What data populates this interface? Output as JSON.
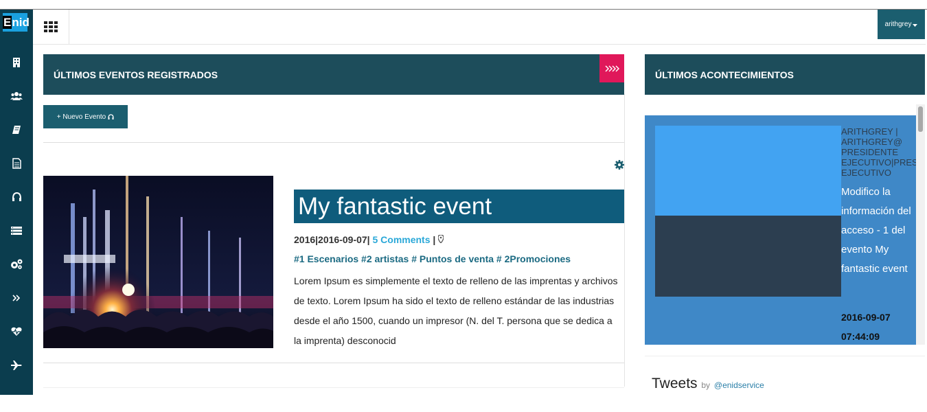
{
  "sidebar": {
    "logo_text": "Enid",
    "logo_first": "E",
    "logo_rest": "nid",
    "icons": [
      "building-icon",
      "users-icon",
      "book-icon",
      "document-icon",
      "headset-icon",
      "list-icon",
      "cogs-icon",
      "double-chevron-icon",
      "heartbeat-icon",
      "plane-icon"
    ]
  },
  "topbar": {
    "user_label": "arithgrey"
  },
  "events_panel": {
    "title": "ÚLTIMOS EVENTOS REGISTRADOS",
    "new_event_label": "+ Nuevo Evento",
    "event": {
      "title": "My fantastic event",
      "date_text": "2016|2016-09-07|",
      "comments": "5 Comments",
      "separator": "|",
      "tags": "#1 Escenarios #2 artistas # Puntos de venta # 2Promociones",
      "description": "Lorem Ipsum es simplemente el texto de relleno de las imprentas y archivos de texto. Lorem Ipsum ha sido el texto de relleno estándar de las industrias desde el año 1500, cuando un impresor (N. del T. persona que se dedica a la imprenta) desconocid"
    }
  },
  "news_panel": {
    "title": "ÚLTIMOS ACONTECIMIENTOS",
    "item": {
      "user": "ARITHGREY |\nARITHGREY@\nPRESIDENTE\nEJECUTIVO|PRESIDENTE\nEJECUTIVO",
      "text": "Modifico la información del acceso - 1 del evento My fantastic event",
      "date": "2016-09-07 07:44:09"
    }
  },
  "tweets": {
    "title": "Tweets",
    "by": "by",
    "handle": "@enidservice"
  },
  "colors": {
    "sidebar": "#0b3d4e",
    "panel_header": "#1d4d5b",
    "accent_pink": "#e0185a",
    "title_blue": "#0f5c7c",
    "feed_bg": "#3f88c7"
  }
}
